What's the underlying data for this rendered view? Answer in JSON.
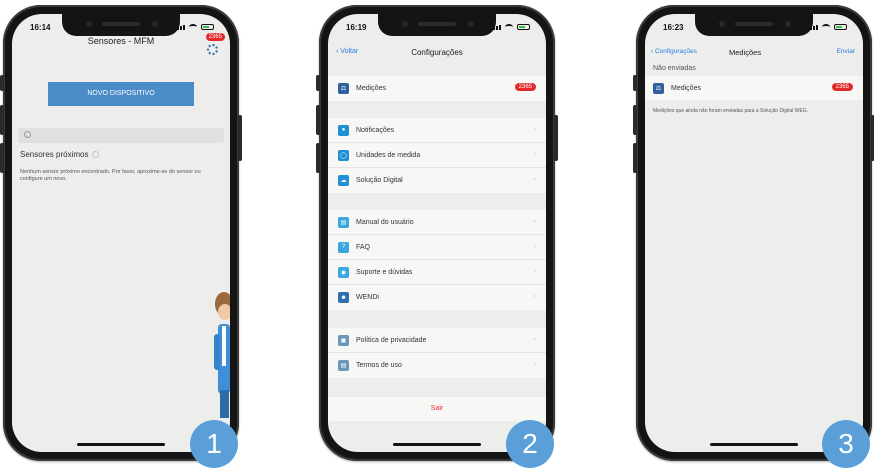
{
  "phones": [
    {
      "step": "1",
      "status_time": "16:14",
      "title": "Sensores - MFM",
      "badge": "2365",
      "primary_button": "NOVO DISPOSITIVO",
      "search_placeholder": "",
      "nearby_heading": "Sensores próximos",
      "empty_message": "Nenhum sensor próximo encontrado. Por favor, aproxime-se do sensor ou configure um novo."
    },
    {
      "step": "2",
      "status_time": "16:19",
      "back_label": "Voltar",
      "title": "Configurações",
      "measurements": {
        "label": "Medições",
        "badge": "2365",
        "icon": "scale-icon",
        "color": "#2f5f9e"
      },
      "group1": [
        {
          "label": "Notificações",
          "icon": "bell-icon",
          "color": "#1f8fd6"
        },
        {
          "label": "Unidades de medida",
          "icon": "measure-icon",
          "color": "#1f8fd6"
        },
        {
          "label": "Solução Digital",
          "icon": "cloud-icon",
          "color": "#1f8fd6"
        }
      ],
      "group2": [
        {
          "label": "Manual do usuário",
          "icon": "book-icon",
          "color": "#3aa7e0"
        },
        {
          "label": "FAQ",
          "icon": "question-icon",
          "color": "#3aa7e0"
        },
        {
          "label": "Suporte e dúvidas",
          "icon": "globe-icon",
          "color": "#3aa7e0"
        },
        {
          "label": "WENDi",
          "icon": "wendi-icon",
          "color": "#2f6fb0"
        }
      ],
      "group3": [
        {
          "label": "Política de privacidade",
          "icon": "privacy-icon",
          "color": "#6b97b8"
        },
        {
          "label": "Termos de uso",
          "icon": "document-icon",
          "color": "#6b97b8"
        }
      ],
      "logout_label": "Sair"
    },
    {
      "step": "3",
      "status_time": "16:23",
      "back_label": "Configurações",
      "title": "Medições",
      "send_label": "Enviar",
      "section": "Não enviadas",
      "row": {
        "label": "Medições",
        "badge": "2365",
        "icon": "scale-icon",
        "color": "#2f5f9e"
      },
      "note": "Medições que ainda não foram enviadas para a Solução Digital WEG."
    }
  ]
}
